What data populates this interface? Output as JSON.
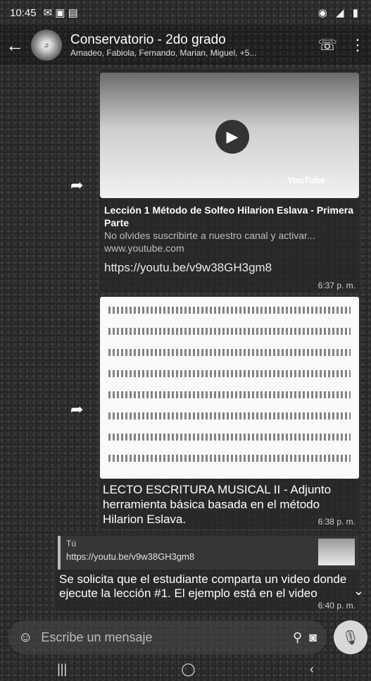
{
  "status": {
    "time": "10:45",
    "right_icons": "◉ ◢ ▮"
  },
  "header": {
    "title": "Conservatorio - 2do grado",
    "members": "Amadeo, Fabiola, Fernando, Marian, Miguel, +5..."
  },
  "messages": [
    {
      "kind": "video",
      "title": "Lección 1 Método de Solfeo Hilarion Eslava - Primera Parte",
      "description": "No olvides suscribirte a nuestro canal y activar... www.youtube.com",
      "provider": "YouTube",
      "url": "https://youtu.be/v9w38GH3gm8",
      "time": "6:37 p. m."
    },
    {
      "kind": "document",
      "caption": "LECTO ESCRITURA MUSICAL II - Adjunto herramienta básica basada en el método Hilarion Eslava.",
      "time": "6:38 p. m."
    },
    {
      "kind": "reply",
      "quote_author": "Tú",
      "quote_text": "https://youtu.be/v9w38GH3gm8",
      "text": "Se solicita que el estudiante comparta un video donde ejecute la lección #1. El ejemplo está en el video",
      "time": "6:40 p. m."
    }
  ],
  "composer": {
    "placeholder": "Escribe un mensaje"
  }
}
